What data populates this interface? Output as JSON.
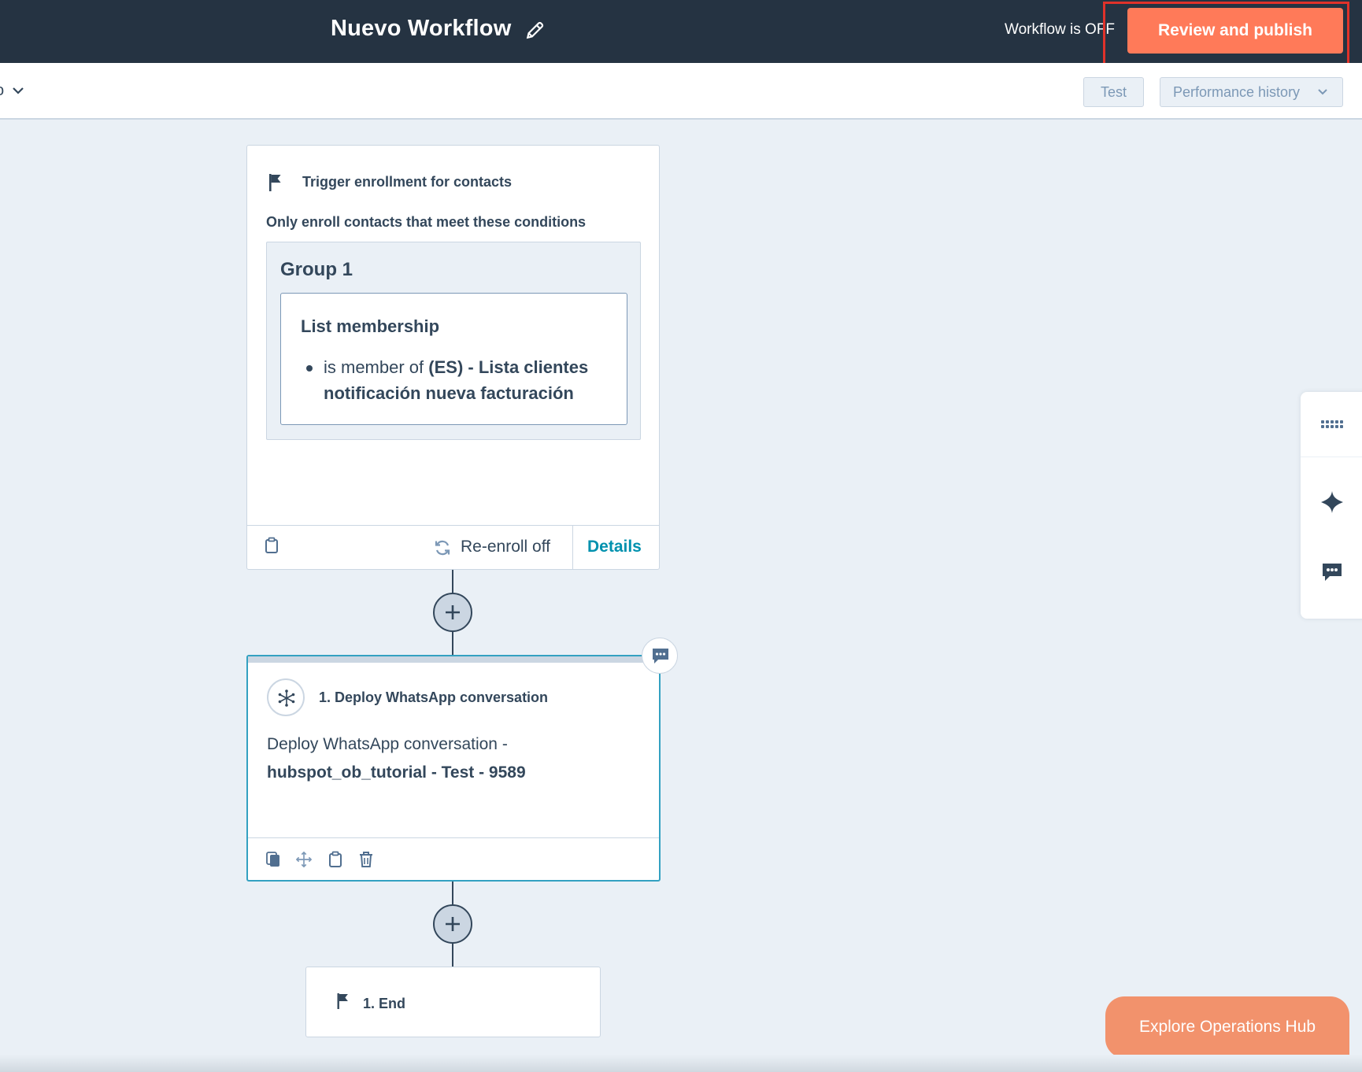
{
  "header": {
    "workflow_title": "Nuevo Workflow",
    "status_text": "Workflow is OFF",
    "publish_label": "Review and publish"
  },
  "toolbar": {
    "partial_label": "o",
    "test_label": "Test",
    "performance_label": "Performance history"
  },
  "trigger": {
    "title": "Trigger enrollment for contacts",
    "subtitle": "Only enroll contacts that meet these conditions",
    "group_title": "Group 1",
    "condition_title": "List membership",
    "condition_prefix": "is member of",
    "condition_value_line1": "(ES) - Lista clientes",
    "condition_value_line2": "notificación nueva facturación",
    "reenroll_label": "Re-enroll off",
    "details_label": "Details"
  },
  "action": {
    "title": "1. Deploy WhatsApp conversation",
    "desc_line1": "Deploy WhatsApp conversation -",
    "desc_line2": "hubspot_ob_tutorial - Test - 9589"
  },
  "end": {
    "label": "1. End"
  },
  "cta": {
    "explore_label": "Explore Operations Hub"
  },
  "icons": {
    "edit": "pencil-icon",
    "flag": "flag-icon",
    "clipboard": "clipboard-icon",
    "refresh": "refresh-icon",
    "plus": "plus-icon",
    "comment": "comment-icon",
    "whatsapp_action": "asterisk-network-icon",
    "copy": "copy-icon",
    "move": "move-icon",
    "trash": "trash-icon",
    "grid": "grid-dots-icon",
    "sparkle": "sparkle-icon"
  },
  "colors": {
    "header_bg": "#253342",
    "accent": "#ff7a59",
    "link": "#0091ae",
    "highlight_border": "#e0322a",
    "canvas_bg": "#eaf0f6"
  }
}
